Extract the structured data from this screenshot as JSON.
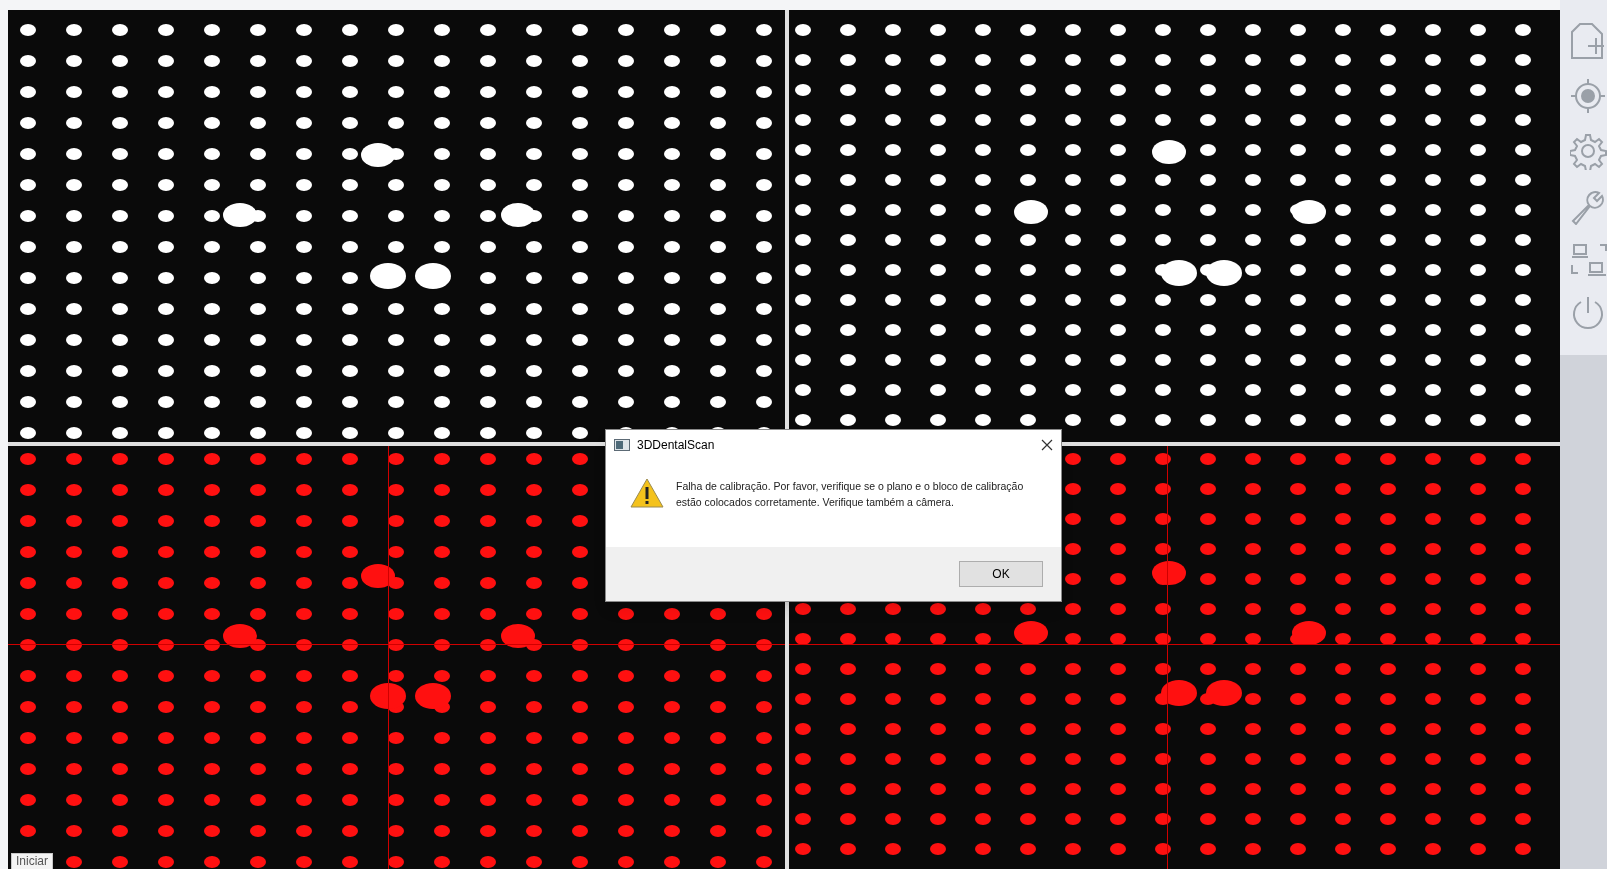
{
  "dialog": {
    "title": "3DDentalScan",
    "message": "Falha de calibração. Por favor, verifique se o plano e o bloco de calibração estão colocados corretamente. Verifique também a câmera.",
    "button": "OK"
  },
  "tooltip": "Iniciar"
}
